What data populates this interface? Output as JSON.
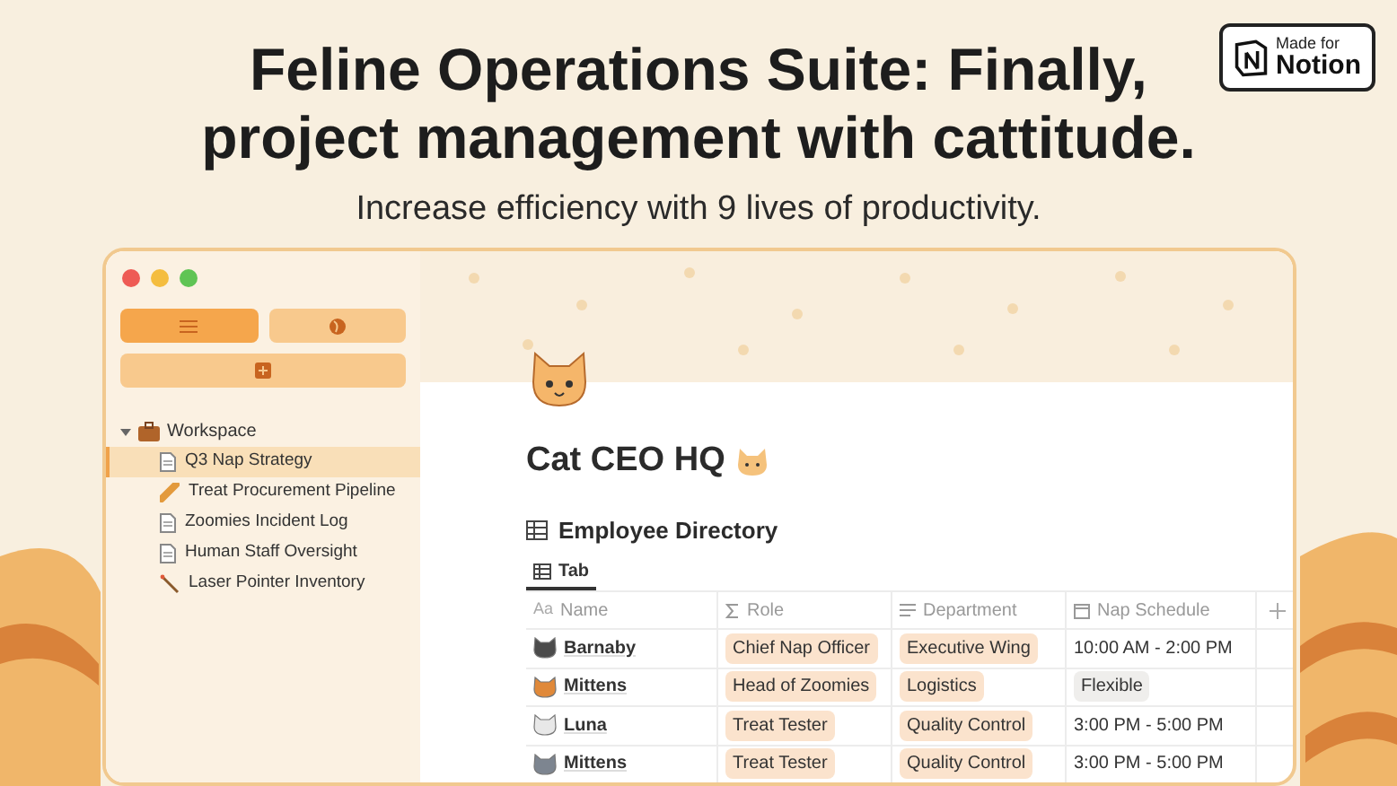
{
  "badge": {
    "line_1": "Made for",
    "line_2": "Notion"
  },
  "headline": [
    "Feline Operations Suite: Finally,",
    "project management with cattitude."
  ],
  "subtitle": "Increase efficiency with 9 lives of productivity.",
  "window": {
    "toolbar": [
      {
        "kind": "list",
        "selected": true
      },
      {
        "kind": "globe",
        "selected": false
      },
      {
        "kind": "add",
        "selected": false
      }
    ],
    "sidebar": {
      "label": "Workspace",
      "expanded": true,
      "children": [
        {
          "label": "Q3 Nap Strategy",
          "kind": "page",
          "selected": true
        },
        {
          "label": "Treat Procurement Pipeline",
          "kind": "treat",
          "selected": false
        },
        {
          "label": "Zoomies Incident Log",
          "kind": "page",
          "selected": false
        },
        {
          "label": "Human Staff Oversight",
          "kind": "page",
          "selected": false
        },
        {
          "label": "Laser Pointer Inventory",
          "kind": "pointer",
          "selected": false
        }
      ]
    },
    "page_title": "Cat CEO HQ",
    "database": {
      "title": "Employee Directory",
      "tabs": [
        {
          "label": "Tab",
          "selected": true
        }
      ],
      "columns": [
        {
          "label": "Name",
          "marker": "Aa"
        },
        {
          "label": "Role"
        },
        {
          "label": "Department"
        },
        {
          "label": "Nap Schedule"
        }
      ],
      "rows": [
        {
          "name": "Barnaby",
          "color": "#4b4b4b",
          "role": "Chief Nap Officer",
          "department": "Executive Wing",
          "schedule": {
            "text": "10:00 AM - 2:00 PM",
            "kind": "text"
          }
        },
        {
          "name": "Mittens",
          "color": "#e0893a",
          "role": "Head of Zoomies",
          "department": "Logistics",
          "schedule": {
            "text": "Flexible",
            "kind": "tag"
          }
        },
        {
          "name": "Luna",
          "color": "#e8e8e8",
          "role": "Treat Tester",
          "department": "Quality Control",
          "schedule": {
            "text": "3:00 PM - 5:00 PM",
            "kind": "text"
          }
        },
        {
          "name": "Mittens",
          "color": "#7d8590",
          "role": "Treat Tester",
          "department": "Quality Control",
          "schedule": {
            "text": "3:00 PM - 5:00 PM",
            "kind": "text"
          }
        }
      ]
    }
  }
}
